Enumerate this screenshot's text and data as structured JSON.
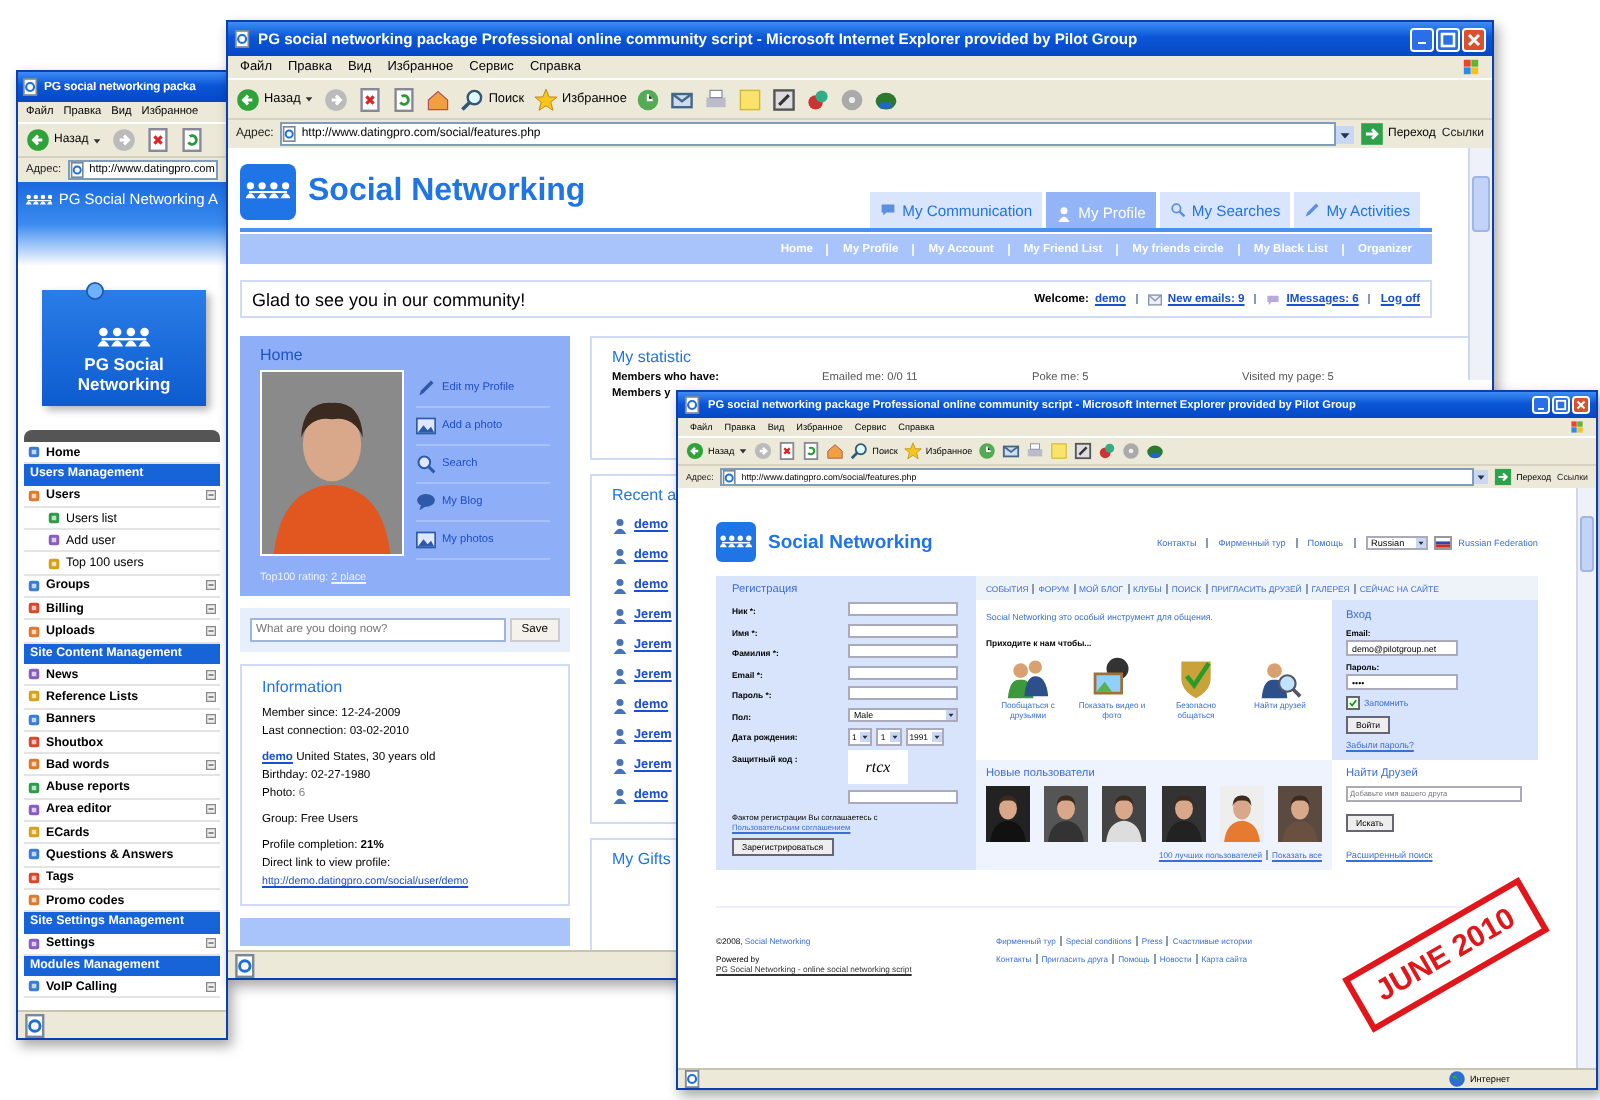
{
  "back_window": {
    "title": "PG social networking packa",
    "menu": [
      "Файл",
      "Правка",
      "Вид",
      "Избранное"
    ],
    "toolbar": {
      "back": "Назад"
    },
    "address_label": "Адрес:",
    "address": "http://www.datingpro.com",
    "site_header": "PG Social Networking A",
    "logo_text": "PG Social Networking",
    "admin_menu": [
      {
        "kind": "item",
        "label": "Home",
        "expandable": false
      },
      {
        "kind": "section",
        "label": "Users Management"
      },
      {
        "kind": "item",
        "label": "Users",
        "expandable": true
      },
      {
        "kind": "subitem",
        "label": "Users list",
        "expandable": false
      },
      {
        "kind": "subitem",
        "label": "Add user",
        "expandable": false
      },
      {
        "kind": "subitem",
        "label": "Top 100 users",
        "expandable": false
      },
      {
        "kind": "item",
        "label": "Groups",
        "expandable": true
      },
      {
        "kind": "item",
        "label": "Billing",
        "expandable": true
      },
      {
        "kind": "item",
        "label": "Uploads",
        "expandable": true
      },
      {
        "kind": "section",
        "label": "Site Content Management"
      },
      {
        "kind": "item",
        "label": "News",
        "expandable": true
      },
      {
        "kind": "item",
        "label": "Reference Lists",
        "expandable": true
      },
      {
        "kind": "item",
        "label": "Banners",
        "expandable": true
      },
      {
        "kind": "item",
        "label": "Shoutbox",
        "expandable": false
      },
      {
        "kind": "item",
        "label": "Bad words",
        "expandable": true
      },
      {
        "kind": "item",
        "label": "Abuse reports",
        "expandable": false
      },
      {
        "kind": "item",
        "label": "Area editor",
        "expandable": true
      },
      {
        "kind": "item",
        "label": "ECards",
        "expandable": true
      },
      {
        "kind": "item",
        "label": "Questions & Answers",
        "expandable": false
      },
      {
        "kind": "item",
        "label": "Tags",
        "expandable": false
      },
      {
        "kind": "item",
        "label": "Promo codes",
        "expandable": false
      },
      {
        "kind": "section",
        "label": "Site Settings Management"
      },
      {
        "kind": "item",
        "label": "Settings",
        "expandable": true
      },
      {
        "kind": "section",
        "label": "Modules Management"
      },
      {
        "kind": "item",
        "label": "VoIP Calling",
        "expandable": true
      }
    ]
  },
  "main_window": {
    "title": "PG social networking package Professional online community script - Microsoft Internet Explorer provided by Pilot Group",
    "menu": [
      "Файл",
      "Правка",
      "Вид",
      "Избранное",
      "Сервис",
      "Справка"
    ],
    "toolbar": {
      "back": "Назад",
      "search": "Поиск",
      "favorites": "Избранное"
    },
    "address_label": "Адрес:",
    "address": "http://www.datingpro.com/social/features.php",
    "go": "Переход",
    "links": "Ссылки",
    "logo": "Social Networking",
    "tabs": [
      {
        "label": "My Communication",
        "selected": false
      },
      {
        "label": "My Profile",
        "selected": true
      },
      {
        "label": "My Searches",
        "selected": false
      },
      {
        "label": "My Activities",
        "selected": false
      }
    ],
    "subnav": [
      "Home",
      "My Profile",
      "My Account",
      "My Friend List",
      "My friends circle",
      "My Black List",
      "Organizer"
    ],
    "greeting": "Glad to see you in our community!",
    "welcome_label": "Welcome:",
    "user": "demo",
    "emails": "New emails: 9",
    "imessages": "IMessages: 6",
    "logoff": "Log off",
    "home": {
      "title": "Home",
      "actions": [
        "Edit my Profile",
        "Add a photo",
        "Search",
        "My Blog",
        "My photos"
      ],
      "rating_label": "Top100 rating:",
      "rating_value": "2 place"
    },
    "status": {
      "placeholder": "What are you doing now?",
      "button": "Save"
    },
    "information": {
      "title": "Information",
      "member_since": "Member since:  12-24-2009",
      "last_connection": "Last connection:  03-02-2010",
      "user_link": "demo",
      "user_info": "United States, 30 years old",
      "birthday": "Birthday: 02-27-1980",
      "photo_label": "Photo:",
      "photo_count": "6",
      "group": "Group: Free Users",
      "completion": "Profile completion: **21%**",
      "link_label": "Direct link to view profile:",
      "link": "http://demo.datingpro.com/social/user/demo"
    },
    "statistic": {
      "title": "My statistic",
      "row_label": "Members who have:",
      "values": [
        "Emailed me: 0/0 11",
        "Poke me: 5",
        "Visited my page: 5"
      ],
      "row2_label": "Members y"
    },
    "recent": {
      "title": "Recent a",
      "items": [
        "demo",
        "demo",
        "demo",
        "Jerem",
        "Jerem",
        "Jerem",
        "demo",
        "Jerem",
        "Jerem",
        "demo"
      ]
    },
    "gifts_title": "My Gifts"
  },
  "front_window": {
    "title": "PG social networking package Professional online community script - Microsoft Internet Explorer provided by Pilot Group",
    "menu": [
      "Файл",
      "Правка",
      "Вид",
      "Избранное",
      "Сервис",
      "Справка"
    ],
    "toolbar": {
      "back": "Назад",
      "search": "Поиск",
      "favorites": "Избранное"
    },
    "address_label": "Адрес:",
    "address": "http://www.datingpro.com/social/features.php",
    "go": "Переход",
    "links": "Ссылки",
    "logo": "Social Networking",
    "top_links": [
      "Контакты",
      "Фирменный тур",
      "Помощь"
    ],
    "language": "Russian",
    "country": "Russian Federation",
    "registration": {
      "title": "Регистрация",
      "fields": [
        {
          "kind": "text",
          "label": "Ник *:"
        },
        {
          "kind": "text",
          "label": "Имя *:"
        },
        {
          "kind": "text",
          "label": "Фамилия *:"
        },
        {
          "kind": "text",
          "label": "Email *:"
        },
        {
          "kind": "text",
          "label": "Пароль *:"
        },
        {
          "kind": "select",
          "label": "Пол:",
          "value": "Male"
        },
        {
          "kind": "date",
          "label": "Дата рождения:",
          "values": [
            "1",
            "1",
            "1991"
          ]
        },
        {
          "kind": "captcha",
          "label": "Защитный код :",
          "value": "rtcx"
        }
      ],
      "agreement": "Фактом регистрации Вы соглашаетесь с",
      "agreement_link": "Пользовательским соглашением",
      "button": "Зарегистрироваться"
    },
    "nav": [
      "СОБЫТИЯ",
      "ФОРУМ",
      "МОЙ БЛОГ",
      "КЛУБЫ",
      "ПОИСК",
      "ПРИГЛАСИТЬ ДРУЗЕЙ",
      "ГАЛЕРЕЯ",
      "СЕЙЧАС НА САЙТЕ"
    ],
    "intro": "Social Networking это особый инструмент для общения.",
    "invite": "Приходите к нам чтобы...",
    "features": [
      "Пообщаться с друзьями",
      "Показать видео и фото",
      "Безопасно общаться",
      "Найти друзей"
    ],
    "new_users": {
      "title": "Новые пользователи",
      "top_link": "100 лучших пользователей",
      "all_link": "Показать все"
    },
    "login": {
      "title": "Вход",
      "email_label": "Email:",
      "email": "demo@pilotgroup.net",
      "password_label": "Пароль:",
      "password": "••••",
      "remember": "Запомнить",
      "remember_checked": true,
      "button": "Войти",
      "forgot": "Забыли пароль?"
    },
    "find": {
      "title": "Найти Друзей",
      "placeholder": "Добавьте имя вашего друга",
      "button": "Искать",
      "advanced": "Расширенный поиск"
    },
    "footer": {
      "copyright": "©2008,",
      "copyright_link": "Social Networking",
      "powered": "Powered by",
      "powered_link": "PG Social Networking - online social networking script",
      "links_1": [
        "Фирменный тур",
        "Special conditions",
        "Press",
        "Счастливые истории"
      ],
      "links_2": [
        "Контакты",
        "Пригласить друга",
        "Помощь",
        "Новости",
        "Карта сайта"
      ]
    },
    "status": "Интернет"
  },
  "stamp": "JUNE 2010"
}
